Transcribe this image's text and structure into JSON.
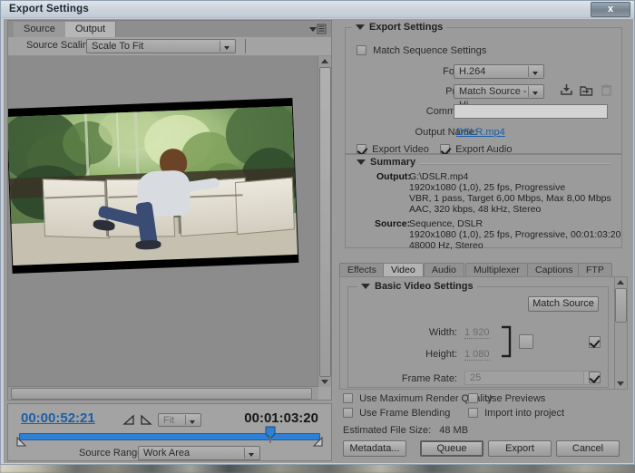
{
  "window": {
    "title": "Export Settings",
    "close_label": "x"
  },
  "left_panel": {
    "tabs": [
      {
        "label": "Source",
        "active": false
      },
      {
        "label": "Output",
        "active": true
      }
    ],
    "panel_menu_icon": "panel-menu-icon",
    "source_scaling": {
      "label": "Source Scaling:",
      "value": "Scale To Fit"
    }
  },
  "timeline": {
    "current_time": "00:00:52:21",
    "duration": "00:01:03:20",
    "in_point_icon": "set-in-point-icon",
    "out_point_icon": "set-out-point-icon",
    "zoom_level": "Fit",
    "source_range_label": "Source Range:",
    "source_range_value": "Work Area"
  },
  "export_settings": {
    "title": "Export Settings",
    "match_sequence_settings": {
      "label": "Match Sequence Settings",
      "checked": false
    },
    "format": {
      "label": "Format:",
      "value": "H.264"
    },
    "preset": {
      "label": "Preset:",
      "value": "Match Source - Hi...",
      "save_icon": "save-preset-icon",
      "import_icon": "import-preset-icon",
      "delete_icon": "delete-preset-icon"
    },
    "comments": {
      "label": "Comments:",
      "value": "",
      "placeholder": ""
    },
    "output_name": {
      "label": "Output Name:",
      "value": "DSLR.mp4"
    },
    "export_video": {
      "label": "Export Video",
      "checked": true
    },
    "export_audio": {
      "label": "Export Audio",
      "checked": true
    }
  },
  "summary": {
    "title": "Summary",
    "output_label": "Output:",
    "output_lines": [
      "G:\\DSLR.mp4",
      "1920x1080 (1,0), 25 fps, Progressive",
      "VBR, 1 pass, Target 6,00 Mbps, Max 8,00 Mbps",
      "AAC, 320 kbps, 48 kHz, Stereo"
    ],
    "source_label": "Source:",
    "source_lines": [
      "Sequence, DSLR",
      "1920x1080 (1,0), 25 fps, Progressive, 00:01:03:20",
      "48000 Hz, Stereo"
    ]
  },
  "settings_tabs": [
    {
      "label": "Effects",
      "active": false
    },
    {
      "label": "Video",
      "active": true
    },
    {
      "label": "Audio",
      "active": false
    },
    {
      "label": "Multiplexer",
      "active": false
    },
    {
      "label": "Captions",
      "active": false
    },
    {
      "label": "FTP",
      "active": false
    }
  ],
  "basic_video_settings": {
    "title": "Basic Video Settings",
    "match_source_button": "Match Source",
    "width": {
      "label": "Width:",
      "value": "1 920"
    },
    "height": {
      "label": "Height:",
      "value": "1 080"
    },
    "link_aspect_checked": false,
    "width_height_checked": true,
    "frame_rate": {
      "label": "Frame Rate:",
      "value": "25",
      "checked": true
    }
  },
  "footer": {
    "use_maximum_render_quality": {
      "label": "Use Maximum Render Quality",
      "checked": false
    },
    "use_previews": {
      "label": "Use Previews",
      "checked": false
    },
    "use_frame_blending": {
      "label": "Use Frame Blending",
      "checked": false
    },
    "import_into_project": {
      "label": "Import into project",
      "checked": false
    },
    "estimated_file_size_label": "Estimated File Size:",
    "estimated_file_size_value": "48 MB",
    "buttons": {
      "metadata": "Metadata...",
      "queue": "Queue",
      "export": "Export",
      "cancel": "Cancel"
    }
  },
  "colors": {
    "accent_blue": "#2f7fd4",
    "link_blue": "#1b5fa8",
    "panel_gray": "#9b9b9b",
    "title_bar": "#ccd4dc"
  }
}
